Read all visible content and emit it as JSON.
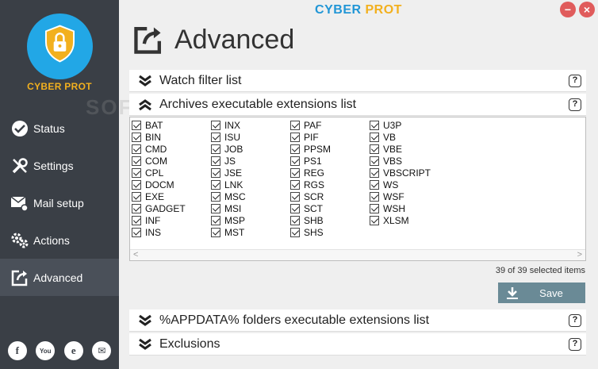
{
  "app": {
    "title_part1": "CYBER",
    "title_part2": "PROT",
    "close_label": "×",
    "minimize_label": "−"
  },
  "sidebar": {
    "logo_text": "CYBER PROT",
    "items": [
      {
        "label": "Status"
      },
      {
        "label": "Settings"
      },
      {
        "label": "Mail setup"
      },
      {
        "label": "Actions"
      },
      {
        "label": "Advanced"
      }
    ],
    "social": [
      "f",
      "You",
      "e",
      "✉"
    ]
  },
  "page": {
    "title": "Advanced"
  },
  "sections": {
    "watch_filter": "Watch filter list",
    "archives": "Archives executable extensions list",
    "appdata": "%APPDATA% folders executable extensions list",
    "exclusions": "Exclusions",
    "help_label": "?"
  },
  "extensions": {
    "col1": [
      "BAT",
      "BIN",
      "CMD",
      "COM",
      "CPL",
      "DOCM",
      "EXE",
      "GADGET",
      "INF",
      "INS"
    ],
    "col2": [
      "INX",
      "ISU",
      "JOB",
      "JS",
      "JSE",
      "LNK",
      "MSC",
      "MSI",
      "MSP",
      "MST"
    ],
    "col3": [
      "PAF",
      "PIF",
      "PPSM",
      "PS1",
      "REG",
      "RGS",
      "SCR",
      "SCT",
      "SHB",
      "SHS"
    ],
    "col4": [
      "U3P",
      "VB",
      "VBE",
      "VBS",
      "VBSCRIPT",
      "WS",
      "WSF",
      "WSH",
      "XLSM"
    ]
  },
  "status": {
    "count_text": "39 of 39 selected items"
  },
  "actions": {
    "save_label": "Save"
  },
  "watermark": "SOFTPEDIA",
  "colors": {
    "sidebar_bg": "#3a3f46",
    "accent_blue": "#2196d6",
    "accent_gold": "#f2b01e",
    "save_bg": "#6a8a96"
  }
}
